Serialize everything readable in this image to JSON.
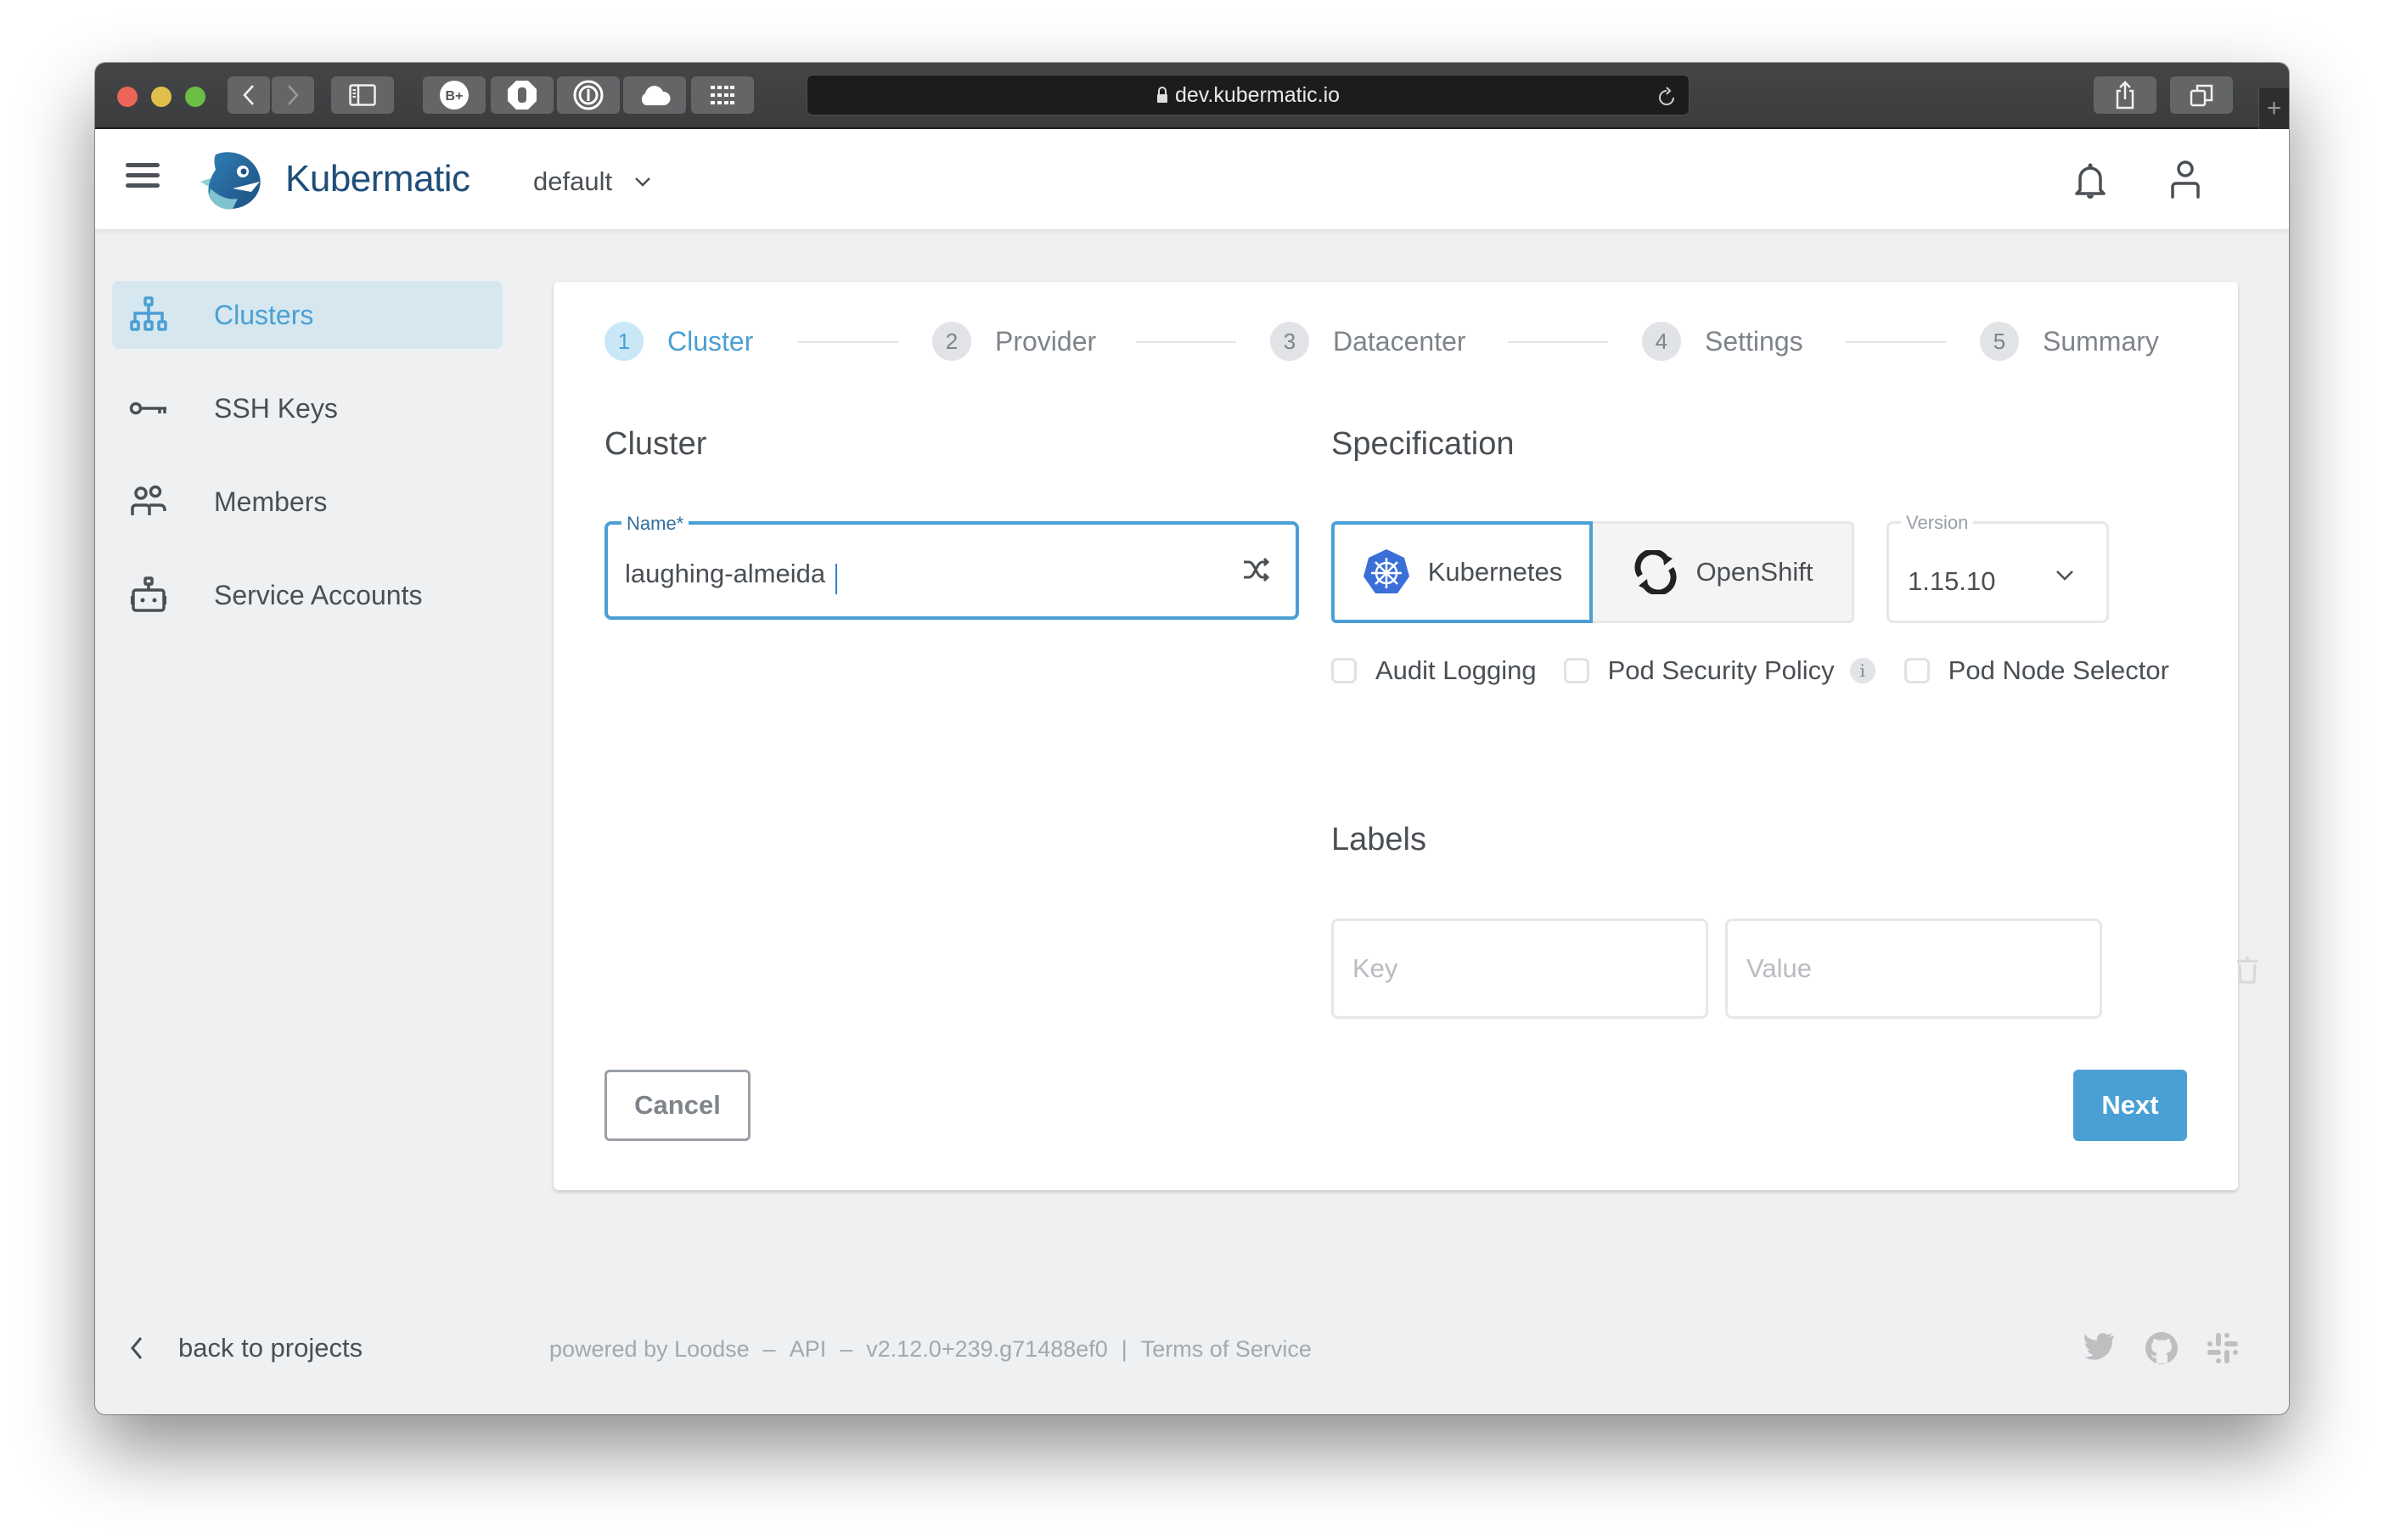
{
  "browser": {
    "url": "dev.kubermatic.io",
    "new_tab_label": "+"
  },
  "header": {
    "brand": "Kubermatic",
    "project": "default"
  },
  "sidebar": {
    "items": [
      {
        "label": "Clusters",
        "icon": "sitemap-icon",
        "active": true
      },
      {
        "label": "SSH Keys",
        "icon": "key-icon",
        "active": false
      },
      {
        "label": "Members",
        "icon": "users-icon",
        "active": false
      },
      {
        "label": "Service Accounts",
        "icon": "robot-icon",
        "active": false
      }
    ],
    "back_label": "back to projects"
  },
  "wizard": {
    "steps": [
      {
        "num": "1",
        "label": "Cluster",
        "active": true
      },
      {
        "num": "2",
        "label": "Provider",
        "active": false
      },
      {
        "num": "3",
        "label": "Datacenter",
        "active": false
      },
      {
        "num": "4",
        "label": "Settings",
        "active": false
      },
      {
        "num": "5",
        "label": "Summary",
        "active": false
      }
    ],
    "cluster_title": "Cluster",
    "name_label": "Name*",
    "name_value": "laughing-almeida",
    "spec_title": "Specification",
    "types": [
      {
        "label": "Kubernetes",
        "selected": true
      },
      {
        "label": "OpenShift",
        "selected": false
      }
    ],
    "version_label": "Version",
    "version_value": "1.15.10",
    "checkboxes": [
      {
        "label": "Audit Logging",
        "checked": false
      },
      {
        "label": "Pod Security Policy",
        "checked": false,
        "info": "i"
      },
      {
        "label": "Pod Node Selector",
        "checked": false
      }
    ],
    "labels_title": "Labels",
    "key_placeholder": "Key",
    "value_placeholder": "Value",
    "cancel_label": "Cancel",
    "next_label": "Next"
  },
  "footer": {
    "powered_by": "powered by Loodse",
    "dash1": "–",
    "api": "API",
    "dash2": "–",
    "version": "v2.12.0+239.g71488ef0",
    "bar": "|",
    "terms": "Terms of Service"
  },
  "colors": {
    "accent": "#4a9fd4",
    "brand": "#1f4e79",
    "active_nav_bg": "#d7e7ef",
    "page_bg": "#eef0f2"
  }
}
